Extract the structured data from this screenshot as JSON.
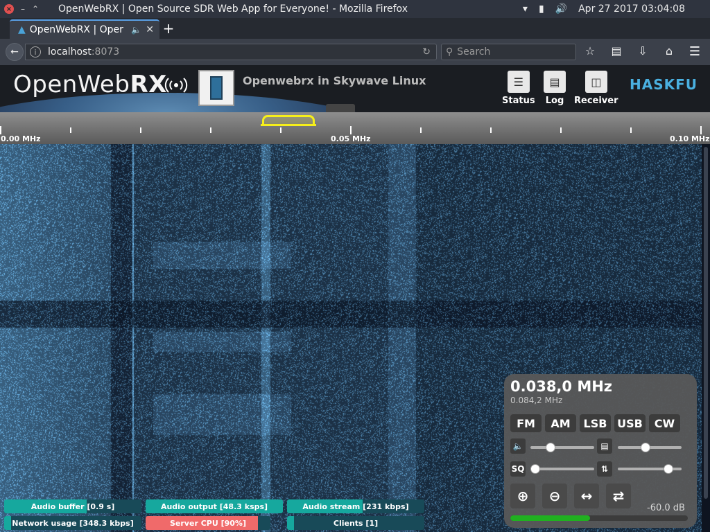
{
  "os": {
    "window_title": "OpenWebRX | Open Source SDR Web App for Everyone! - Mozilla Firefox",
    "datetime": "Apr 27 2017 03:04:08",
    "close_glyph": "×",
    "minimize_glyph": "–",
    "maximize_glyph": "⌃"
  },
  "browser": {
    "tab_title": "OpenWebRX | Oper",
    "new_tab": "+",
    "url_host": "localhost",
    "url_port": ":8073",
    "search_placeholder": "Search"
  },
  "header": {
    "logo_text": "OpenWeb",
    "logo_bold": "RX",
    "receiver_title": "Openwebrx in Skywave Linux",
    "buttons": [
      {
        "label": "Status",
        "icon": "status-icon"
      },
      {
        "label": "Log",
        "icon": "log-icon"
      },
      {
        "label": "Receiver",
        "icon": "receiver-icon"
      }
    ],
    "partner_logo": "HASKFU"
  },
  "scale": {
    "labels": [
      "0.00 MHz",
      "0.05 MHz",
      "0.10 MHz"
    ]
  },
  "receiver_panel": {
    "frequency": "0.038,0 MHz",
    "center_frequency": "0.084,2 MHz",
    "modes": [
      "FM",
      "AM",
      "LSB",
      "USB",
      "CW"
    ],
    "volume_icon": "volume-icon",
    "nr_icon": "noise-reduction-icon",
    "squelch_label": "SQ",
    "agc_icon": "agc-icon",
    "volume_level": 0.28,
    "nr_level": 0.42,
    "squelch_level": 0.0,
    "agc_level": 0.84,
    "smeter_db": "-60.0 dB",
    "smeter_level": 0.45
  },
  "status": [
    {
      "label": "Audio buffer [0.9 s]",
      "level": 0.6,
      "color": "#16a89e"
    },
    {
      "label": "Audio output [48.3 ksps]",
      "level": 1.0,
      "color": "#16a89e"
    },
    {
      "label": "Audio stream [231 kbps]",
      "level": 0.55,
      "color": "#16a89e"
    },
    {
      "label": "Network usage [348.3 kbps]",
      "level": 0.05,
      "color": "#16a89e"
    },
    {
      "label": "Server CPU [90%]",
      "level": 0.9,
      "color": "#f06a6a"
    },
    {
      "label": "Clients [1]",
      "level": 0.05,
      "color": "#16a89e"
    }
  ],
  "colors": {
    "passband": "#f6ef1a",
    "waterfall_bg": "#08101c",
    "signal": "#7fc4ee"
  }
}
